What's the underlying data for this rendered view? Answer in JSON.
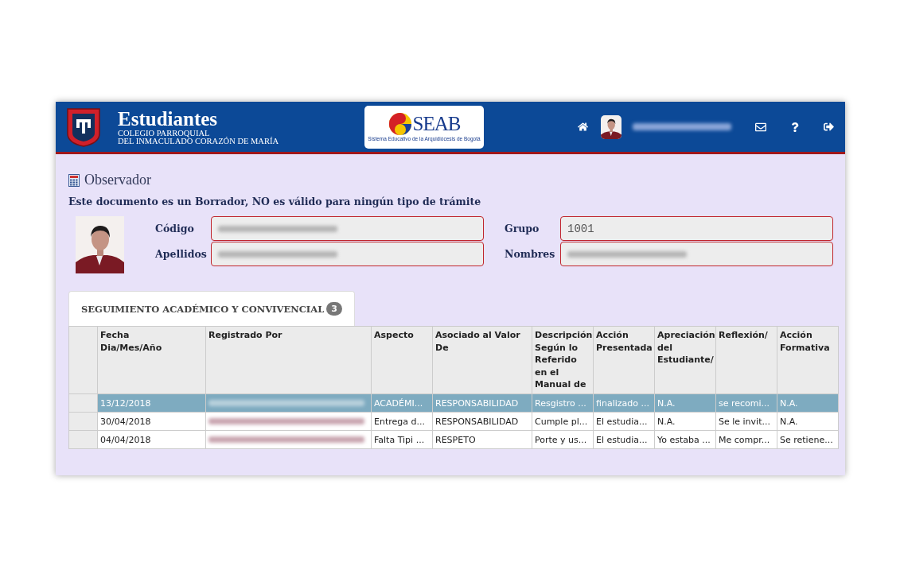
{
  "header": {
    "title": "Estudiantes",
    "school_lines": [
      "COLEGIO PARROQUIAL",
      "DEL INMACULADO CORAZÓN DE MARÍA"
    ],
    "partner_logo": {
      "name": "SEAB",
      "caption": "Sistema Educativo de la Arquidiócesis de Bogotá"
    }
  },
  "page": {
    "title": "Observador",
    "notice": "Este documento es un Borrador, NO es válido para ningún tipo de trámite"
  },
  "student_fields": [
    {
      "label": "Código"
    },
    {
      "label": "Grupo",
      "value": "1001"
    },
    {
      "label": "Apellidos"
    },
    {
      "label": "Nombres"
    }
  ],
  "tabs": [
    {
      "label": "SEGUIMIENTO ACADÉMICO Y CONVIVENCIAL",
      "count": "3",
      "selected": true
    }
  ],
  "table": {
    "columns": [
      "Fecha\nDia/Mes/Año",
      "Registrado Por",
      "Aspecto",
      "Asociado al Valor De",
      "Descripción Según lo Referido en el Manual de",
      "Acción Presentada",
      "Apreciación del Estudiante/",
      "Reflexión/",
      "Acción Formativa"
    ],
    "rows": [
      {
        "selected": true,
        "cells": [
          "13/12/2018",
          "",
          "ACADÉMI...",
          "RESPONSABILIDAD",
          "Resgistro ...",
          "finalizado ...",
          "N.A.",
          "se recomi...",
          "N.A."
        ]
      },
      {
        "selected": false,
        "cells": [
          "30/04/2018",
          "",
          "Entrega d...",
          "RESPONSABILIDAD",
          "Cumple pl...",
          "El estudia...",
          "N.A.",
          "Se le invit...",
          "N.A."
        ]
      },
      {
        "selected": false,
        "cells": [
          "04/04/2018",
          "",
          "Falta Tipi ...",
          "RESPETO",
          "Porte y us...",
          "El estudia...",
          "Yo estaba ...",
          "Me compr...",
          "Se retiene..."
        ]
      }
    ]
  }
}
